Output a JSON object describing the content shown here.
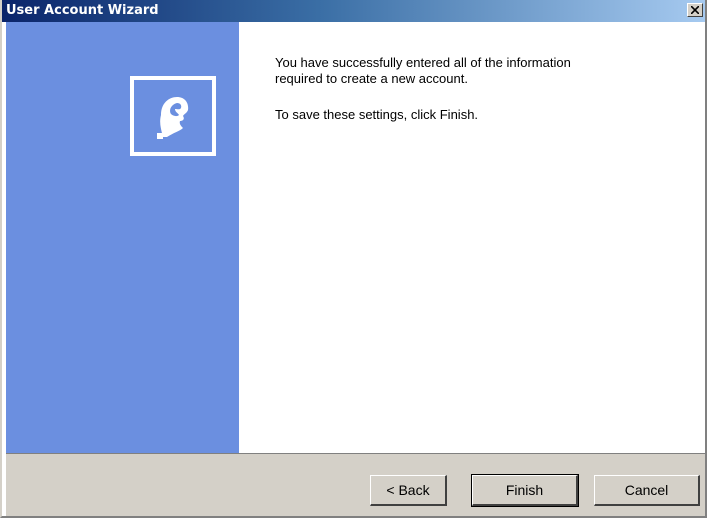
{
  "window": {
    "title": "User Account Wizard",
    "close_symbol": "×"
  },
  "sidebar": {
    "color": "#6b8fe0",
    "icon": "user-account-icon"
  },
  "content": {
    "message_line1": "You have successfully entered all of the information",
    "message_line2": "required to create a new account.",
    "instruction": "To save these settings, click Finish."
  },
  "buttons": {
    "back_label": "< Back",
    "finish_label": "Finish",
    "cancel_label": "Cancel"
  }
}
